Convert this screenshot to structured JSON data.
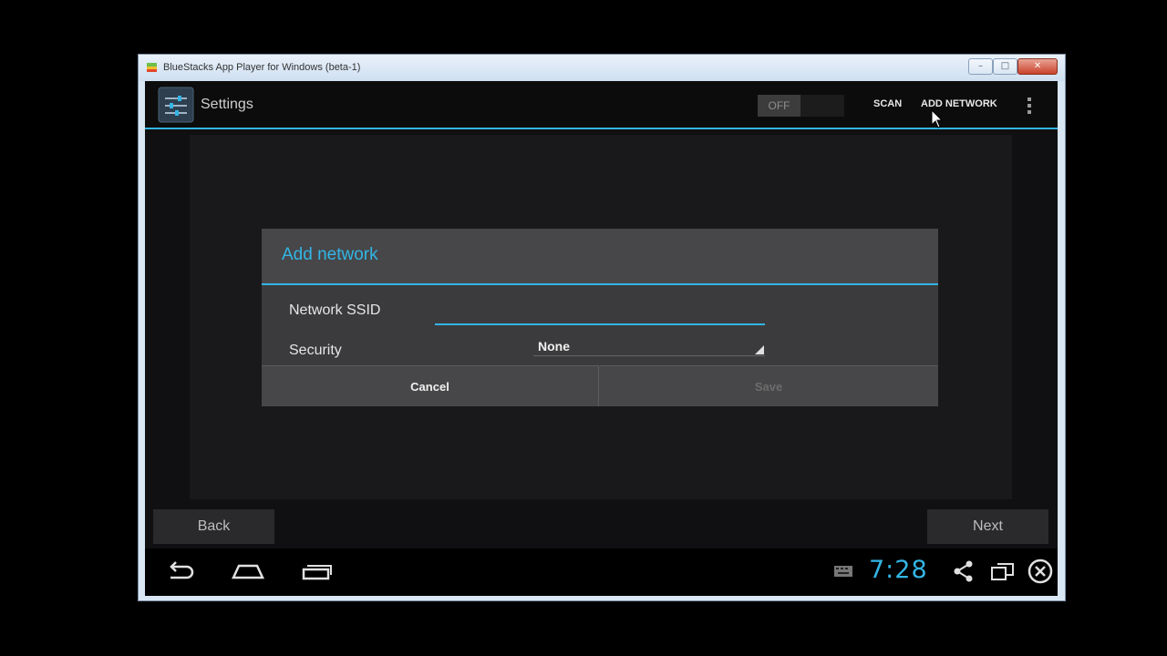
{
  "window": {
    "title": "BlueStacks App Player for Windows (beta-1)",
    "controls": {
      "minimize": "–",
      "maximize": "□",
      "close": "✕"
    }
  },
  "action_bar": {
    "title": "Settings",
    "icon": "settings-icon",
    "wifi_toggle": "OFF",
    "scan_label": "SCAN",
    "add_network_label": "ADD NETWORK",
    "overflow_icon": "overflow-menu-icon"
  },
  "dialog": {
    "title": "Add network",
    "ssid_label": "Network SSID",
    "ssid_value": "",
    "security_label": "Security",
    "security_value": "None",
    "cancel_label": "Cancel",
    "save_label": "Save"
  },
  "wizard": {
    "back_label": "Back",
    "next_label": "Next"
  },
  "navbar": {
    "clock": "7:28",
    "icons": [
      "back-icon",
      "home-icon",
      "recent-apps-icon",
      "keyboard-icon",
      "share-icon",
      "window-icon",
      "close-circle-icon"
    ]
  },
  "colors": {
    "accent": "#33b5e5",
    "dialog_bg": "#474749",
    "screen_bg": "#101012"
  }
}
